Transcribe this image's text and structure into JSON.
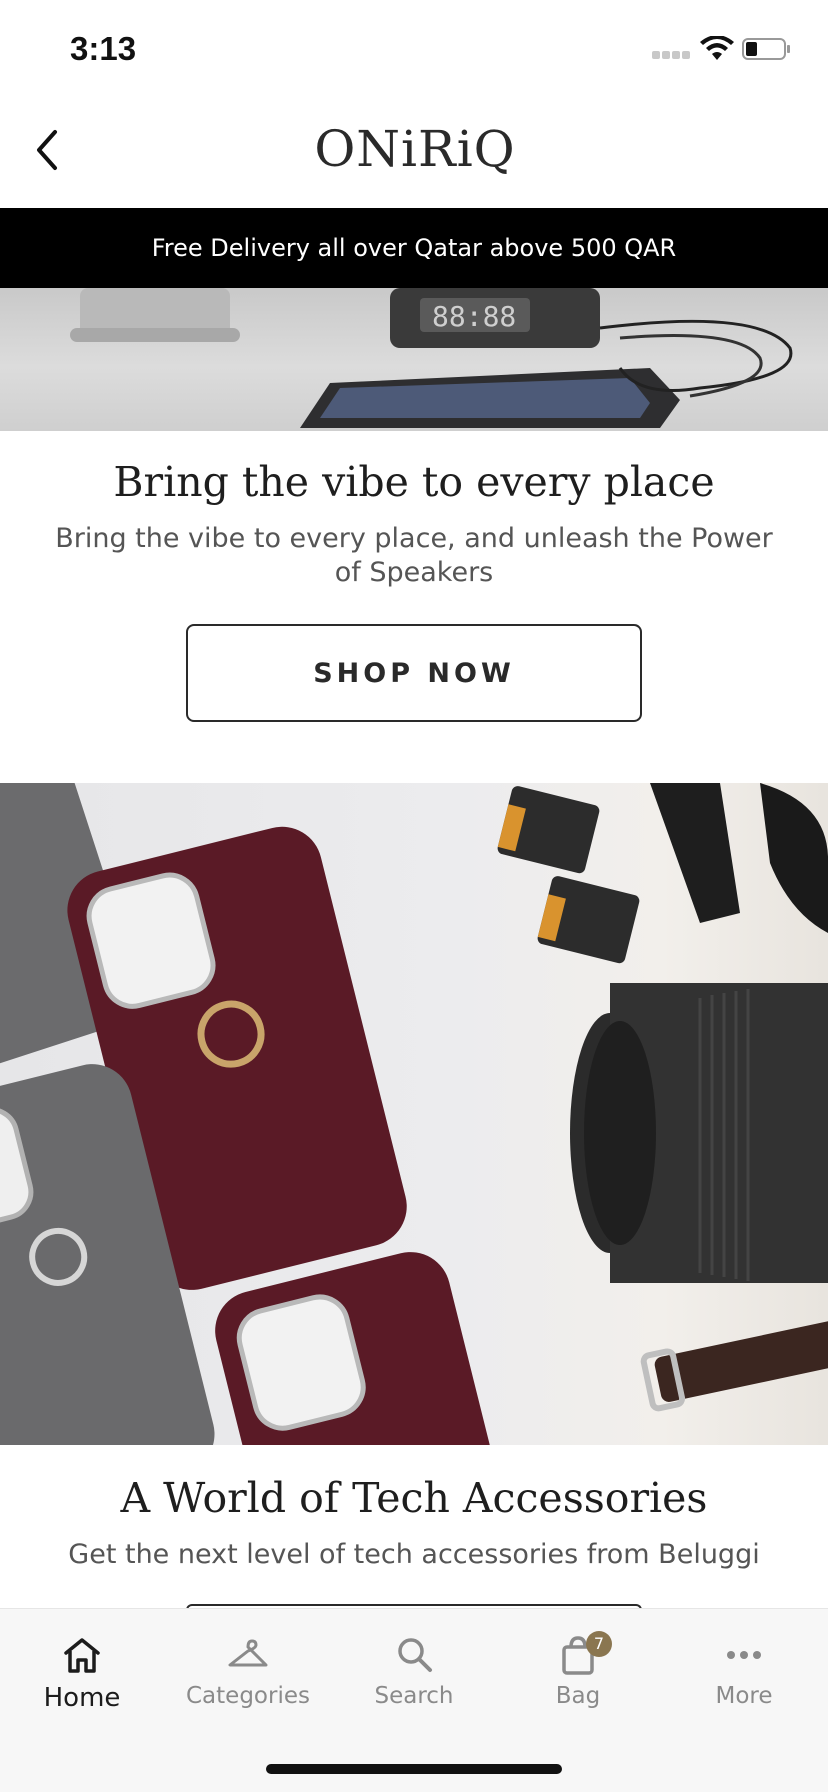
{
  "status_bar": {
    "time": "3:13"
  },
  "header": {
    "logo_text": "ONiRiQ",
    "back_icon": "chevron-left-icon"
  },
  "promo": {
    "text": "Free Delivery all over Qatar above 500 QAR"
  },
  "sections": [
    {
      "title": "Bring the vibe to every place",
      "subtitle": "Bring the vibe to every place, and unleash the Power of Speakers",
      "button_label": "SHOP NOW"
    },
    {
      "title": "A World of Tech Accessories",
      "subtitle": "Get the next level of tech accessories from Beluggi"
    }
  ],
  "tab_bar": {
    "items": [
      {
        "label": "Home",
        "icon": "home-icon",
        "active": true
      },
      {
        "label": "Categories",
        "icon": "hanger-icon",
        "active": false
      },
      {
        "label": "Search",
        "icon": "search-icon",
        "active": false
      },
      {
        "label": "Bag",
        "icon": "bag-icon",
        "active": false,
        "badge": "7"
      },
      {
        "label": "More",
        "icon": "more-dots-icon",
        "active": false
      }
    ]
  },
  "colors": {
    "promo_bg": "#000000",
    "badge": "#8a7650",
    "tab_bar_bg": "#f7f7f7"
  }
}
